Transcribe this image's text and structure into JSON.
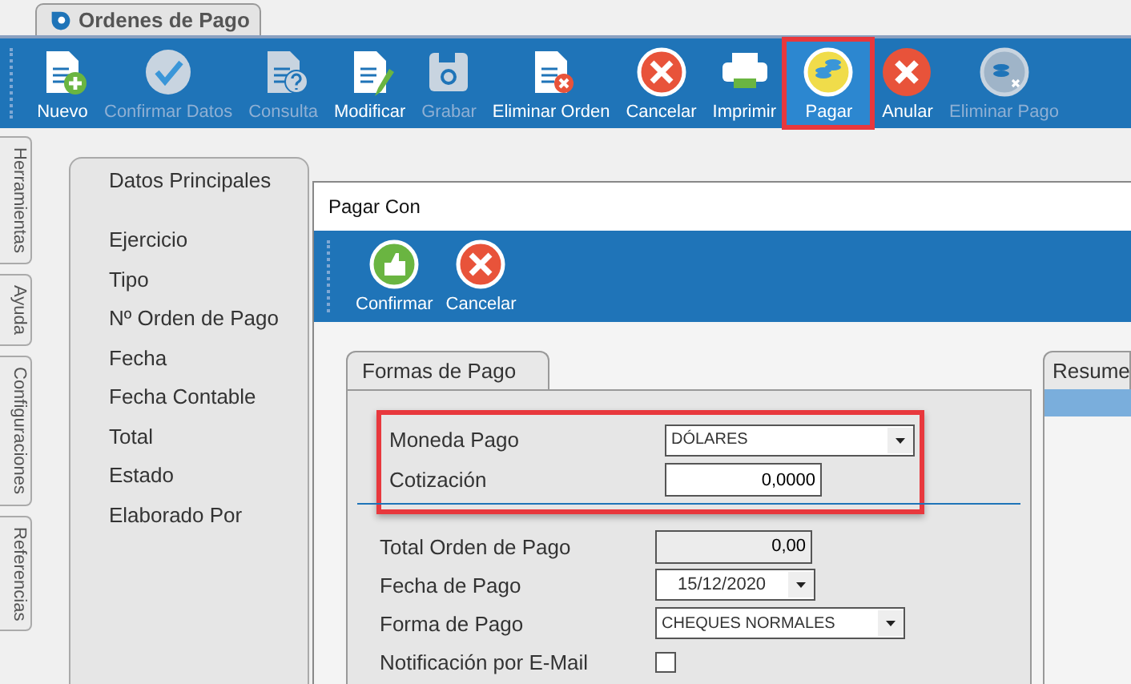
{
  "app_tab": {
    "title": "Ordenes de Pago"
  },
  "toolbar": [
    {
      "label": "Nuevo",
      "kind": "new",
      "disabled": false,
      "highlighted": false
    },
    {
      "label": "Confirmar Datos",
      "kind": "confirm",
      "disabled": true,
      "highlighted": false
    },
    {
      "label": "Consulta",
      "kind": "query",
      "disabled": true,
      "highlighted": false
    },
    {
      "label": "Modificar",
      "kind": "edit",
      "disabled": false,
      "highlighted": false
    },
    {
      "label": "Grabar",
      "kind": "save",
      "disabled": true,
      "highlighted": false
    },
    {
      "label": "Eliminar Orden",
      "kind": "delete",
      "disabled": false,
      "highlighted": false
    },
    {
      "label": "Cancelar",
      "kind": "cancel",
      "disabled": false,
      "highlighted": false
    },
    {
      "label": "Imprimir",
      "kind": "print",
      "disabled": false,
      "highlighted": false
    },
    {
      "label": "Pagar",
      "kind": "pay",
      "disabled": false,
      "highlighted": true
    },
    {
      "label": "Anular",
      "kind": "void",
      "disabled": false,
      "highlighted": false
    },
    {
      "label": "Eliminar Pago",
      "kind": "unpay",
      "disabled": true,
      "highlighted": false
    }
  ],
  "side_tabs": [
    "Herramientas",
    "Ayuda",
    "Configuraciones",
    "Referencias"
  ],
  "main_panel": {
    "tab": "Datos Principales",
    "labels": [
      "Ejercicio",
      "Tipo",
      "Nº Orden de Pago",
      "Fecha",
      "Fecha Contable",
      "Total",
      "Estado",
      "Elaborado Por"
    ]
  },
  "dialog": {
    "title": "Pagar Con",
    "toolbar": [
      {
        "label": "Confirmar",
        "kind": "confirm"
      },
      {
        "label": "Cancelar",
        "kind": "cancel"
      }
    ],
    "tab": "Formas de Pago",
    "highlighted_fields": [
      {
        "label": "Moneda Pago",
        "kind": "select",
        "value": "DÓLARES"
      },
      {
        "label": "Cotización",
        "kind": "number",
        "value": "0,0000"
      }
    ],
    "fields": [
      {
        "label": "Total Orden de Pago",
        "kind": "readonly",
        "value": "0,00"
      },
      {
        "label": "Fecha de Pago",
        "kind": "date",
        "value": "15/12/2020"
      },
      {
        "label": "Forma de Pago",
        "kind": "select",
        "value": "CHEQUES NORMALES"
      },
      {
        "label": "Notificación por E-Mail",
        "kind": "checkbox",
        "checked": false
      }
    ],
    "side_tab": "Resume"
  }
}
